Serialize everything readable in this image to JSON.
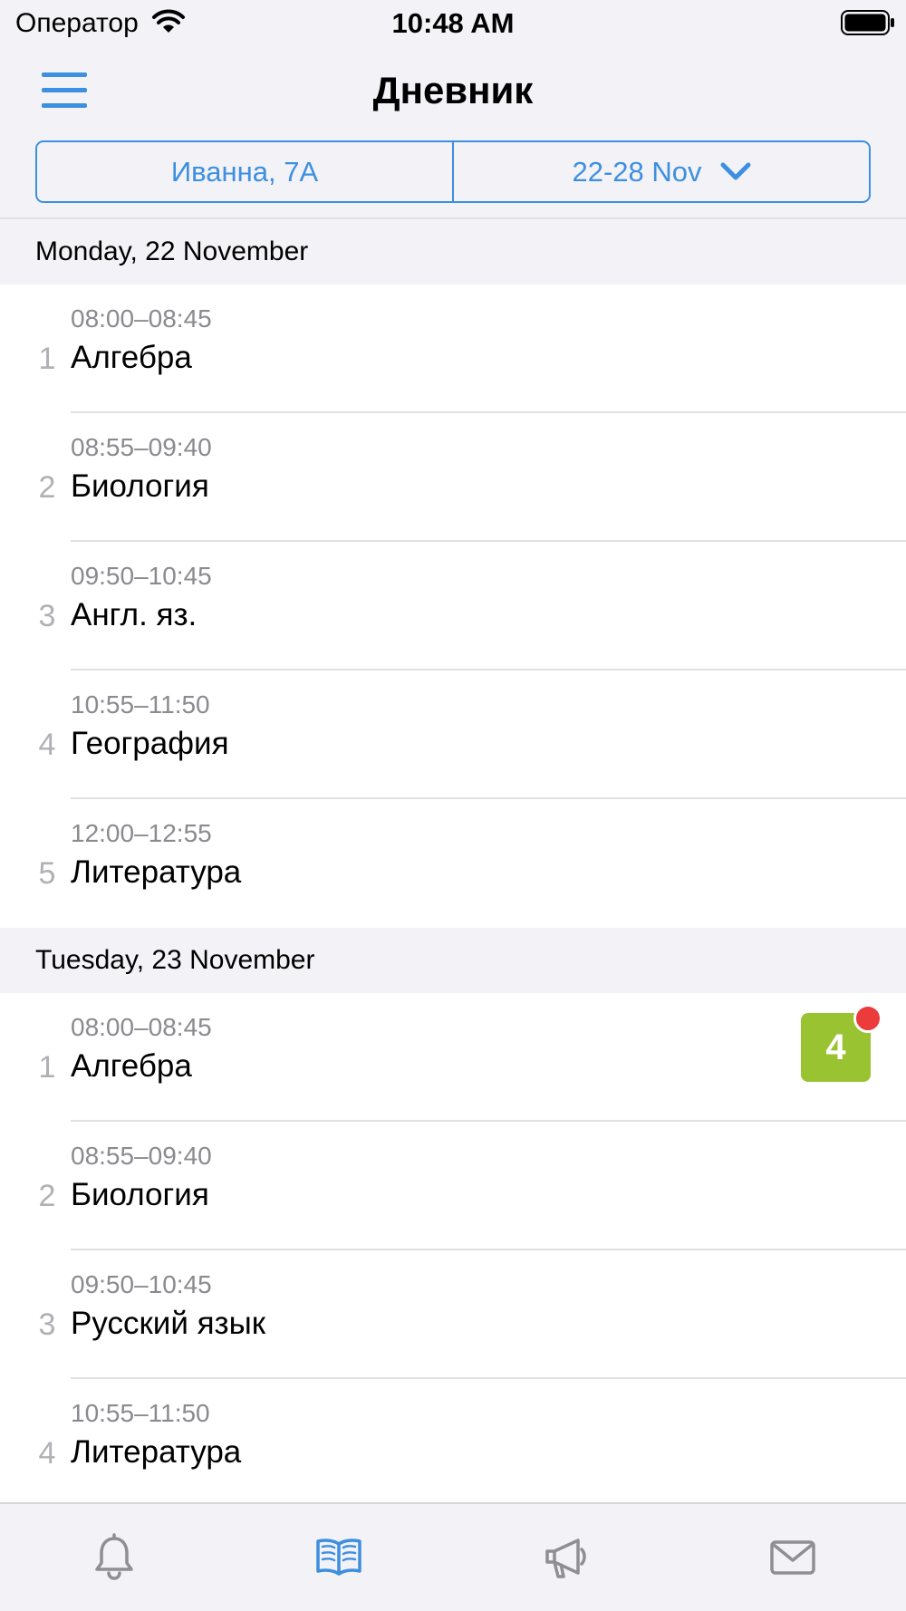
{
  "status_bar": {
    "carrier": "Оператор",
    "time": "10:48 AM"
  },
  "header": {
    "title": "Дневник",
    "student_selector": "Иванна, 7А",
    "week_selector": "22-28 Nov"
  },
  "days": [
    {
      "label": "Monday, 22 November",
      "lessons": [
        {
          "num": "1",
          "time": "08:00–08:45",
          "subject": "Алгебра"
        },
        {
          "num": "2",
          "time": "08:55–09:40",
          "subject": "Биология"
        },
        {
          "num": "3",
          "time": "09:50–10:45",
          "subject": "Англ. яз."
        },
        {
          "num": "4",
          "time": "10:55–11:50",
          "subject": "География"
        },
        {
          "num": "5",
          "time": "12:00–12:55",
          "subject": "Литература"
        }
      ]
    },
    {
      "label": "Tuesday, 23 November",
      "lessons": [
        {
          "num": "1",
          "time": "08:00–08:45",
          "subject": "Алгебра",
          "grade": "4"
        },
        {
          "num": "2",
          "time": "08:55–09:40",
          "subject": "Биология"
        },
        {
          "num": "3",
          "time": "09:50–10:45",
          "subject": "Русский язык"
        },
        {
          "num": "4",
          "time": "10:55–11:50",
          "subject": "Литература"
        }
      ]
    }
  ],
  "tab_bar": {
    "tabs": [
      "bell-icon",
      "book-open-icon",
      "megaphone-icon",
      "envelope-icon"
    ],
    "active": "book-open-icon"
  },
  "colors": {
    "accent": "#3d8fe0",
    "grade": "#99c331",
    "badge": "#ec3b3b",
    "inactive_icon": "#8e8e93"
  }
}
